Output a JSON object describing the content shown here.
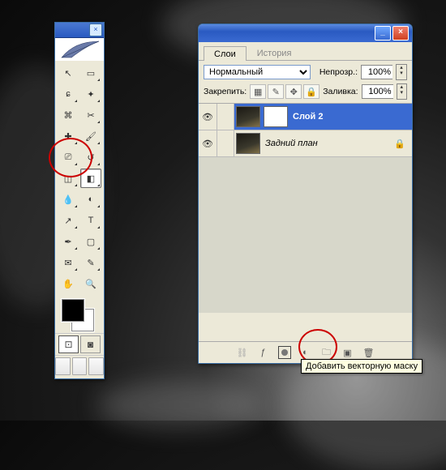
{
  "toolbox": {
    "tools": [
      {
        "name": "move",
        "glyph": "↖",
        "tri": false
      },
      {
        "name": "rect-marquee",
        "glyph": "▭",
        "tri": true
      },
      {
        "name": "lasso",
        "glyph": "ɕ",
        "tri": true
      },
      {
        "name": "magic-wand",
        "glyph": "✦",
        "tri": true
      },
      {
        "name": "crop",
        "glyph": "⌘",
        "tri": false
      },
      {
        "name": "slice",
        "glyph": "✂",
        "tri": true
      },
      {
        "name": "healing-brush",
        "glyph": "✚",
        "tri": true
      },
      {
        "name": "brush",
        "glyph": "🖌",
        "tri": true
      },
      {
        "name": "clone-stamp",
        "glyph": "⎚",
        "tri": true
      },
      {
        "name": "history-brush",
        "glyph": "↺",
        "tri": true
      },
      {
        "name": "eraser",
        "glyph": "◫",
        "tri": true
      },
      {
        "name": "gradient",
        "glyph": "◧",
        "tri": true,
        "selected": true
      },
      {
        "name": "blur",
        "glyph": "💧",
        "tri": true
      },
      {
        "name": "dodge",
        "glyph": "◐",
        "tri": true
      },
      {
        "name": "path-select",
        "glyph": "↗",
        "tri": true
      },
      {
        "name": "type",
        "glyph": "T",
        "tri": true
      },
      {
        "name": "pen",
        "glyph": "✒",
        "tri": true
      },
      {
        "name": "shape",
        "glyph": "▢",
        "tri": true
      },
      {
        "name": "notes",
        "glyph": "✉",
        "tri": true
      },
      {
        "name": "eyedropper",
        "glyph": "✎",
        "tri": true
      },
      {
        "name": "hand",
        "glyph": "✋",
        "tri": false
      },
      {
        "name": "zoom",
        "glyph": "🔍",
        "tri": false
      }
    ],
    "colors": {
      "fg": "#000000",
      "bg": "#ffffff"
    },
    "mask_mode_buttons": [
      "⊡",
      "◙"
    ],
    "screen_mode_buttons": [
      "▣",
      "▣",
      "▣"
    ]
  },
  "layers_panel": {
    "window_buttons": {
      "minimize": "_",
      "close": "×"
    },
    "tabs": {
      "layers": "Слои",
      "history": "История",
      "active": "layers"
    },
    "blend_mode": "Нормальный",
    "opacity_label": "Непрозр.:",
    "opacity_value": "100%",
    "lock_label": "Закрепить:",
    "fill_label": "Заливка:",
    "fill_value": "100%",
    "lock_buttons": [
      {
        "name": "lock-transparent",
        "glyph": "▦"
      },
      {
        "name": "lock-pixels",
        "glyph": "✎"
      },
      {
        "name": "lock-position",
        "glyph": "✥"
      },
      {
        "name": "lock-all",
        "glyph": "🔒"
      }
    ],
    "layers": [
      {
        "name": "Слой 2",
        "selected": true,
        "has_mask": true,
        "locked": false
      },
      {
        "name": "Задний план",
        "selected": false,
        "has_mask": false,
        "locked": true
      }
    ],
    "footer_icons": [
      {
        "name": "link",
        "glyph": "⛓",
        "disabled": true
      },
      {
        "name": "layer-style",
        "glyph": "ƒ",
        "disabled": false
      },
      {
        "name": "add-mask",
        "glyph": "mask",
        "disabled": false
      },
      {
        "name": "new-fill-adjust",
        "glyph": "◐",
        "disabled": false
      },
      {
        "name": "new-group",
        "glyph": "🗀",
        "disabled": false
      },
      {
        "name": "new-layer",
        "glyph": "▣",
        "disabled": false
      },
      {
        "name": "delete",
        "glyph": "🗑",
        "disabled": false
      }
    ],
    "tooltip": "Добавить векторную маску"
  }
}
